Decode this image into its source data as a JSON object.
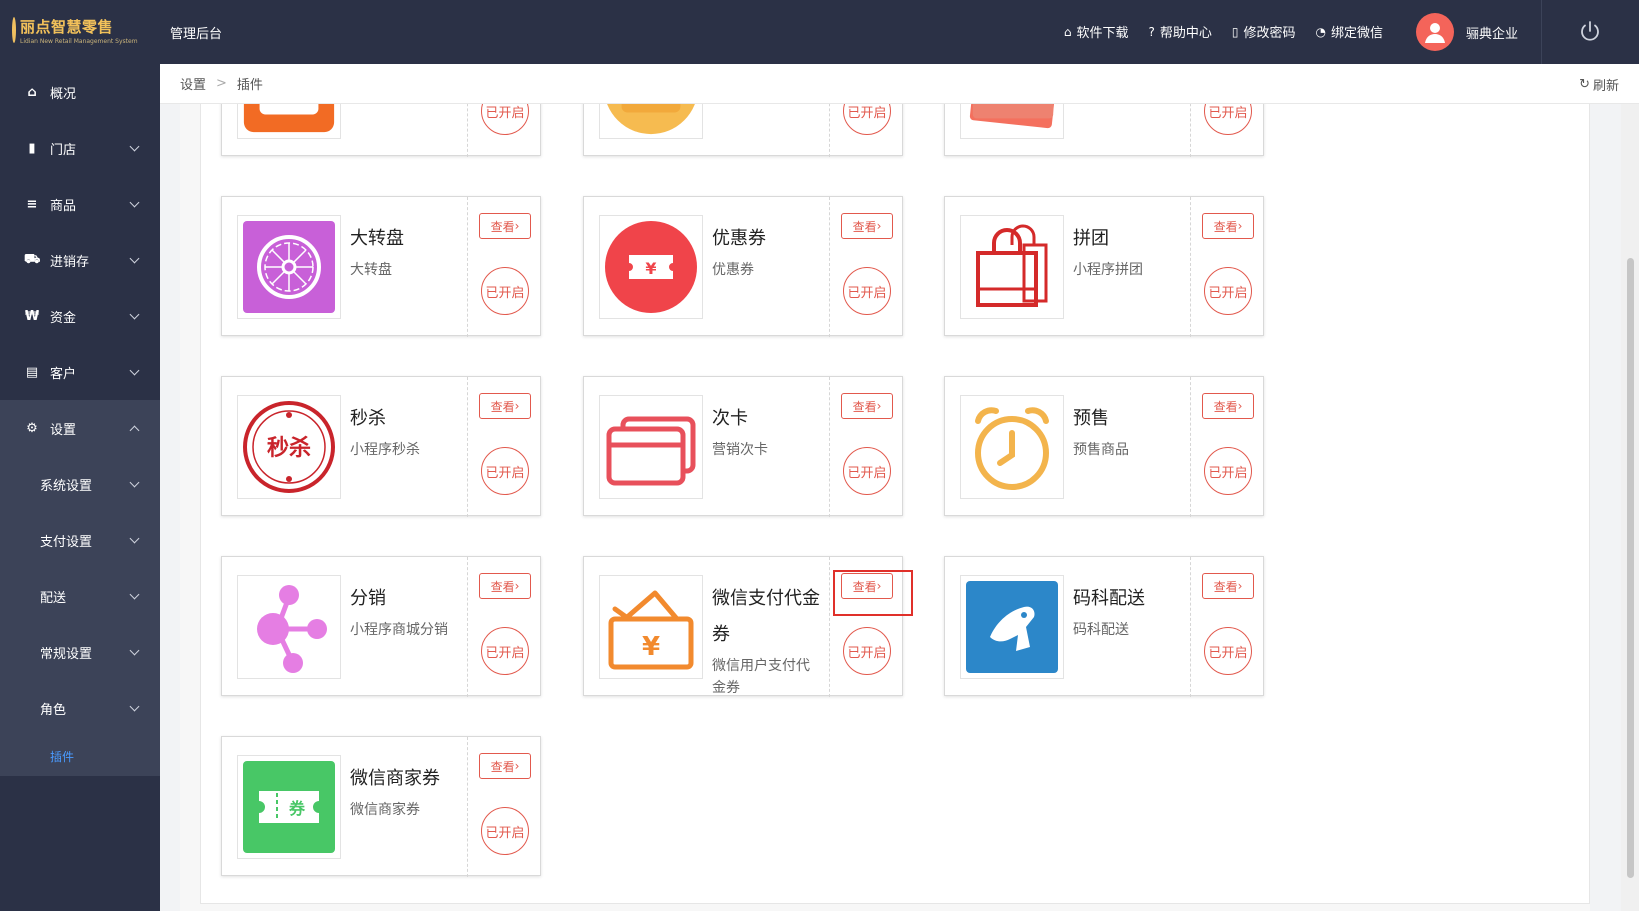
{
  "header": {
    "logo_name": "丽点智慧零售",
    "logo_sub": "Lidian New Retail Management System",
    "admin_title": "管理后台",
    "links": [
      {
        "icon": "store-icon",
        "glyph": "⌂",
        "label": "软件下载"
      },
      {
        "icon": "help-icon",
        "glyph": "?",
        "label": "帮助中心"
      },
      {
        "icon": "lock-icon",
        "glyph": "▯",
        "label": "修改密码"
      },
      {
        "icon": "wechat-icon",
        "glyph": "◔",
        "label": "绑定微信"
      }
    ],
    "user_name": "骊典企业"
  },
  "sidebar": {
    "items": [
      {
        "label": "概况",
        "glyph": "⌂"
      },
      {
        "label": "门店",
        "glyph": "▮"
      },
      {
        "label": "商品",
        "glyph": "≡"
      },
      {
        "label": "进销存",
        "glyph": "⛟"
      },
      {
        "label": "资金",
        "glyph": "₩"
      },
      {
        "label": "客户",
        "glyph": "▤"
      },
      {
        "label": "设置",
        "glyph": "⚙"
      }
    ],
    "sub_items": [
      "系统设置",
      "支付设置",
      "配送",
      "常规设置",
      "角色"
    ],
    "leaf": "插件"
  },
  "breadcrumb": {
    "root": "设置",
    "current": "插件",
    "refresh": "刷新"
  },
  "plugins": {
    "view_label": "查看",
    "status_label": "已开启",
    "cards": [
      {
        "title": "",
        "desc": "",
        "icon": "partial-orange-icon"
      },
      {
        "title": "",
        "desc": "",
        "icon": "partial-yellow-icon"
      },
      {
        "title": "",
        "desc": "",
        "icon": "partial-red-card-icon"
      },
      {
        "title": "大转盘",
        "desc": "大转盘",
        "icon": "lucky-wheel-icon"
      },
      {
        "title": "优惠券",
        "desc": "优惠券",
        "icon": "coupon-icon"
      },
      {
        "title": "拼团",
        "desc": "小程序拼团",
        "icon": "group-buy-bag-icon"
      },
      {
        "title": "秒杀",
        "desc": "小程序秒杀",
        "icon": "flash-sale-icon"
      },
      {
        "title": "次卡",
        "desc": "营销次卡",
        "icon": "times-card-icon"
      },
      {
        "title": "预售",
        "desc": "预售商品",
        "icon": "alarm-clock-icon"
      },
      {
        "title": "分销",
        "desc": "小程序商城分销",
        "icon": "distribution-icon"
      },
      {
        "title": "微信支付代金券",
        "desc": "微信用户支付代金券",
        "icon": "wallet-yen-icon"
      },
      {
        "title": "码科配送",
        "desc": "码科配送",
        "icon": "horse-logo-icon"
      },
      {
        "title": "微信商家券",
        "desc": "微信商家券",
        "icon": "merchant-coupon-icon"
      }
    ]
  },
  "colors": {
    "sidebar_bg": "#2b3146",
    "accent_red": "#e2594d",
    "active_blue": "#4a9bff"
  }
}
